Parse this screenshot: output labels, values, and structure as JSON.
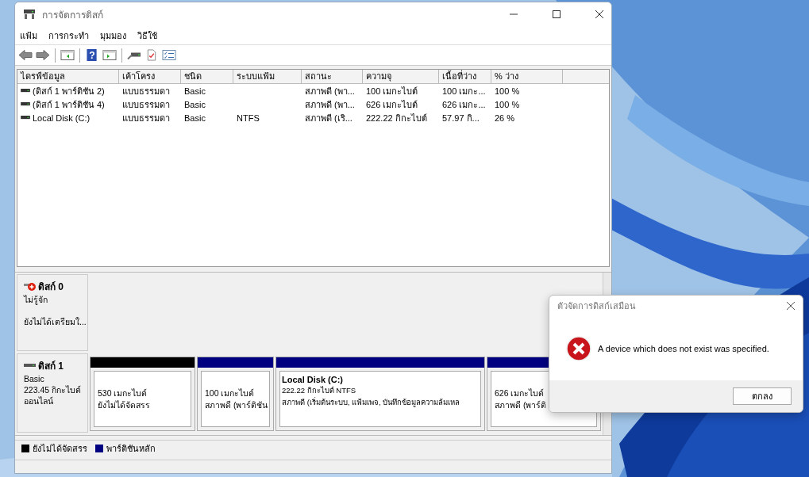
{
  "window": {
    "title": "การจัดการดิสก์"
  },
  "toolbar": {
    "help_glyph": "?"
  },
  "menu": [
    "แฟ้ม",
    "การกระทำ",
    "มุมมอง",
    "วิธีใช้"
  ],
  "table": {
    "columns": [
      "ไดรฟ์ข้อมูล",
      "เค้าโครง",
      "ชนิด",
      "ระบบแฟ้ม",
      "สถานะ",
      "ความจุ",
      "เนื้อที่ว่าง",
      "% ว่าง"
    ],
    "rows": [
      [
        "(ดิสก์ 1 พาร์ติชัน 2)",
        "แบบธรรมดา",
        "Basic",
        "",
        "สภาพดี (พา...",
        "100 เมกะไบต์",
        "100 เมกะ...",
        "100 %"
      ],
      [
        "(ดิสก์ 1 พาร์ติชัน 4)",
        "แบบธรรมดา",
        "Basic",
        "",
        "สภาพดี (พา...",
        "626 เมกะไบต์",
        "626 เมกะ...",
        "100 %"
      ],
      [
        "Local Disk (C:)",
        "แบบธรรมดา",
        "Basic",
        "NTFS",
        "สภาพดี (เริ...",
        "222.22 กิกะไบต์",
        "57.97 กิ...",
        "26 %"
      ]
    ]
  },
  "disks": [
    {
      "kind": "error",
      "name": "ดิสก์ 0",
      "lines": [
        "ไม่รู้จัก",
        "ยังไม่ได้เตรียมใ..."
      ]
    },
    {
      "kind": "online",
      "name": "ดิสก์ 1",
      "lines": [
        "Basic",
        "223.45 กิกะไบต์",
        "ออนไลน์"
      ],
      "partitions": [
        {
          "color": "#000000",
          "lines": [
            "530 เมกะไบต์",
            "ยังไม่ได้จัดสรร"
          ]
        },
        {
          "color": "#000080",
          "lines": [
            "100 เมกะไบต์",
            "สภาพดี (พาร์ติชัน"
          ]
        },
        {
          "color": "#000080",
          "title": "Local Disk  (C:)",
          "lines": [
            "222.22 กิกะไบต์ NTFS",
            "สภาพดี (เริ่มต้นระบบ, แฟ้มเพจ, บันทึกข้อมูลความล้มเหล"
          ]
        },
        {
          "color": "#000080",
          "lines": [
            "626 เมกะไบต์",
            "สภาพดี (พาร์ติ"
          ]
        }
      ]
    }
  ],
  "legend": [
    {
      "color": "#000000",
      "label": "ยังไม่ได้จัดสรร"
    },
    {
      "color": "#000080",
      "label": "พาร์ติชันหลัก"
    }
  ],
  "dialog": {
    "title": "ตัวจัดการดิสก์เสมือน",
    "message": "A device which does not exist was specified.",
    "button": "ตกลง"
  }
}
